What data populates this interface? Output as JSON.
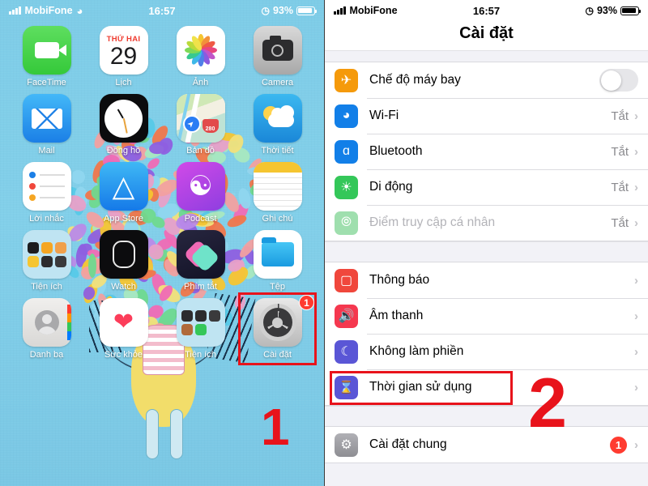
{
  "left_screen": {
    "name": "iphone-home-screen",
    "status_bar": {
      "carrier": "MobiFone",
      "time": "16:57",
      "battery_percent": "93%",
      "signal_icon": "signal-bars-icon",
      "wifi_icon": "wifi-icon",
      "alarm_icon": "alarm-clock-icon",
      "battery_icon": "battery-icon"
    },
    "apps": [
      {
        "label": "FaceTime",
        "icon": "facetime-icon"
      },
      {
        "label": "Lịch",
        "icon": "calendar-icon",
        "weekday": "THỨ HAI",
        "day": "29"
      },
      {
        "label": "Ảnh",
        "icon": "photos-icon"
      },
      {
        "label": "Camera",
        "icon": "camera-icon"
      },
      {
        "label": "Mail",
        "icon": "mail-icon"
      },
      {
        "label": "Đồng hồ",
        "icon": "clock-icon"
      },
      {
        "label": "Bản đồ",
        "icon": "maps-icon",
        "route_shield": "280"
      },
      {
        "label": "Thời tiết",
        "icon": "weather-icon"
      },
      {
        "label": "Lời nhắc",
        "icon": "reminders-icon"
      },
      {
        "label": "App Store",
        "icon": "app-store-icon"
      },
      {
        "label": "Podcast",
        "icon": "podcasts-icon"
      },
      {
        "label": "Ghi chú",
        "icon": "notes-icon"
      },
      {
        "label": "Tiện ích",
        "icon": "folder-icon"
      },
      {
        "label": "Watch",
        "icon": "watch-icon"
      },
      {
        "label": "Phím tắt",
        "icon": "shortcuts-icon"
      },
      {
        "label": "Tệp",
        "icon": "files-icon"
      },
      {
        "label": "Danh bạ",
        "icon": "contacts-icon"
      },
      {
        "label": "Sức khỏe",
        "icon": "health-icon"
      },
      {
        "label": "Tiện ích",
        "icon": "folder-icon"
      },
      {
        "label": "Cài đặt",
        "icon": "settings-gear-icon",
        "badge": "1"
      }
    ],
    "annotation": {
      "step": "1"
    },
    "colors": {
      "wallpaper": "#7ecbe6",
      "annotation_red": "#e8131b",
      "badge_red": "#ff3b30"
    }
  },
  "right_screen": {
    "name": "ios-settings-app",
    "status_bar": {
      "carrier": "MobiFone",
      "time": "16:57",
      "battery_percent": "93%",
      "signal_icon": "signal-bars-icon",
      "alarm_icon": "alarm-clock-icon",
      "battery_icon": "battery-icon"
    },
    "nav_title": "Cài đặt",
    "group_1": [
      {
        "label": "Chế độ máy bay",
        "icon": "airplane-icon",
        "control": "toggle",
        "toggle_on": false
      },
      {
        "label": "Wi-Fi",
        "icon": "wifi-icon",
        "value": "Tắt",
        "control": "chevron"
      },
      {
        "label": "Bluetooth",
        "icon": "bluetooth-icon",
        "value": "Tắt",
        "control": "chevron"
      },
      {
        "label": "Di động",
        "icon": "cellular-icon",
        "value": "Tắt",
        "control": "chevron"
      },
      {
        "label": "Điểm truy cập cá nhân",
        "icon": "hotspot-icon",
        "value": "Tắt",
        "control": "chevron",
        "disabled": true
      }
    ],
    "group_2": [
      {
        "label": "Thông báo",
        "icon": "notifications-icon",
        "control": "chevron"
      },
      {
        "label": "Âm thanh",
        "icon": "sound-icon",
        "control": "chevron"
      },
      {
        "label": "Không làm phiền",
        "icon": "do-not-disturb-icon",
        "control": "chevron"
      },
      {
        "label": "Thời gian sử dụng",
        "icon": "screen-time-icon",
        "control": "chevron",
        "highlighted": true
      }
    ],
    "group_3": [
      {
        "label": "Cài đặt chung",
        "icon": "general-settings-icon",
        "badge": "1",
        "control": "chevron"
      }
    ],
    "annotation": {
      "step": "2"
    },
    "colors": {
      "background": "#f2f2f7",
      "row_bg": "#ffffff",
      "value_text": "#8a8a8e",
      "annotation_red": "#e8131b",
      "badge_red": "#ff3b30"
    }
  }
}
